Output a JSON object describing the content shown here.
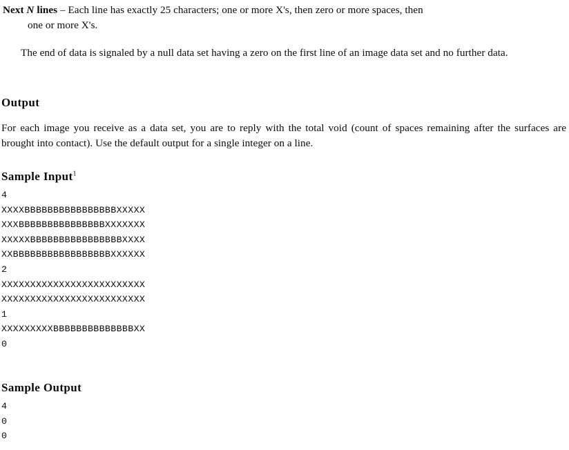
{
  "document": {
    "input_spec_item": {
      "lead_label": "Next",
      "variable": "N",
      "lead_label_tail": "lines",
      "dash": "–",
      "text_line1": "Each line has exactly 25 characters; one or more X's, then zero or more spaces, then",
      "text_line2": "one or more X's.",
      "char_literal": "X"
    },
    "end_of_data_paragraph": "The end of data is signaled by a null data set having a zero on the first line of an image data set and no further data.",
    "output_section": {
      "heading": "Output",
      "paragraph": "For each image you receive as a data set, you are to reply with the total void (count of spaces remaining after the surfaces are brought into contact). Use the default output for a single integer on a line."
    },
    "sample_input_section": {
      "heading": "Sample Input",
      "footnote_marker": "1",
      "lines": [
        "4",
        "XXXXBBBBBBBBBBBBBBBBXXXXX",
        "XXXBBBBBBBBBBBBBBBXXXXXXX",
        "XXXXXBBBBBBBBBBBBBBBBXXXX",
        "XXBBBBBBBBBBBBBBBBBXXXXXX",
        "2",
        "XXXXXXXXXXXXXXXXXXXXXXXXX",
        "XXXXXXXXXXXXXXXXXXXXXXXXX",
        "1",
        "XXXXXXXXXBBBBBBBBBBBBBBXX",
        "0"
      ]
    },
    "sample_output_section": {
      "heading": "Sample Output",
      "lines": [
        "4",
        "0",
        "0"
      ]
    }
  }
}
